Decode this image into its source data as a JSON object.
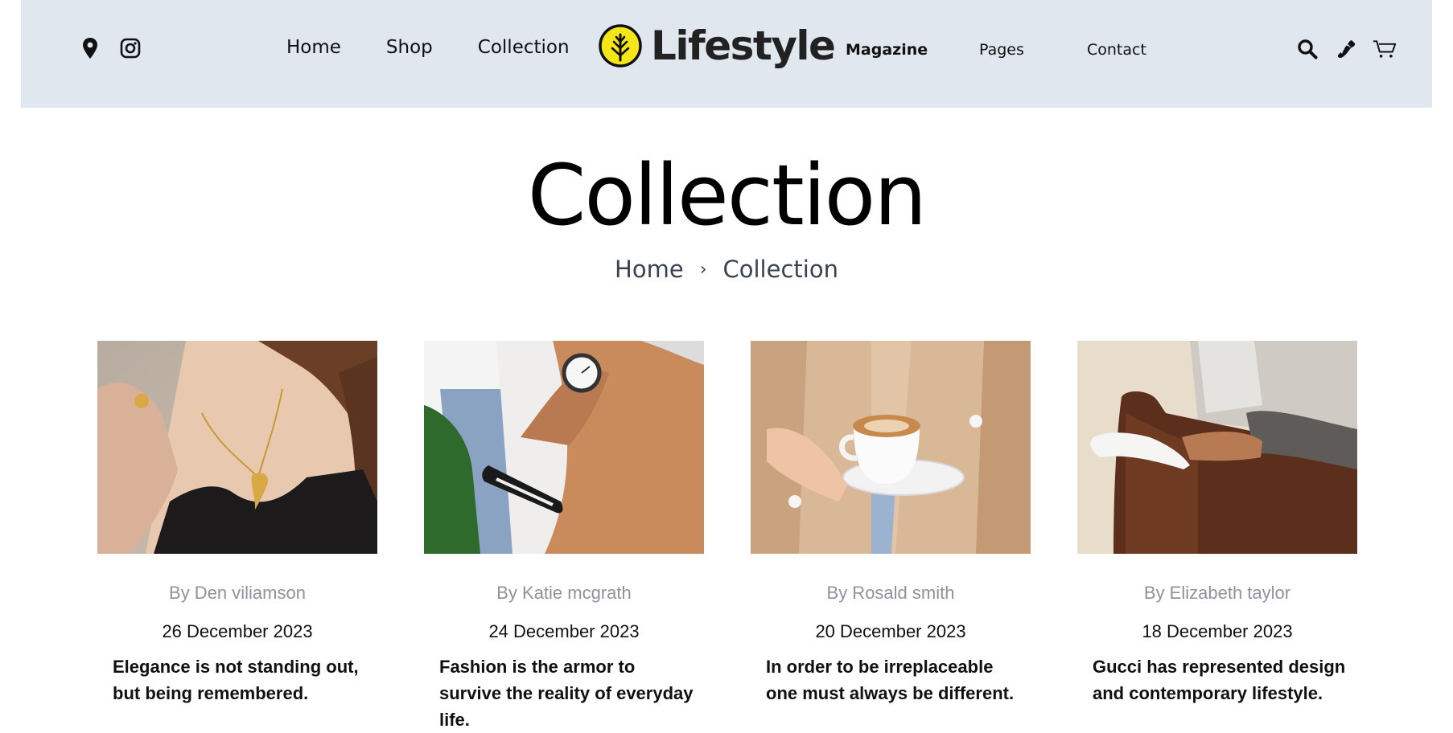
{
  "header": {
    "nav_left": [
      {
        "label": "Home"
      },
      {
        "label": "Shop"
      },
      {
        "label": "Collection"
      }
    ],
    "logo_text": "Lifestyle",
    "nav_right": [
      {
        "label": "Magazine"
      },
      {
        "label": "Pages"
      },
      {
        "label": "Contact"
      }
    ],
    "left_icons": [
      "location-pin-icon",
      "instagram-icon"
    ],
    "right_icons": [
      "search-icon",
      "phone-icon",
      "cart-icon"
    ]
  },
  "page": {
    "title": "Collection",
    "breadcrumb": {
      "home": "Home",
      "separator": "›",
      "current": "Collection"
    }
  },
  "cards": [
    {
      "author": "By Den viliamson",
      "date": "26 December 2023",
      "headline": "Elegance is not standing out, but being remembered.",
      "image": "woman-necklace-photo"
    },
    {
      "author": "By Katie mcgrath",
      "date": "24 December 2023",
      "headline": "Fashion is the armor to survive the reality of everyday life.",
      "image": "wristwatch-sunglasses-photo"
    },
    {
      "author": "By Rosald smith",
      "date": "20 December 2023",
      "headline": "In order to be irreplaceable one must always be different.",
      "image": "coffee-cup-photo"
    },
    {
      "author": "By Elizabeth taylor",
      "date": "18 December 2023",
      "headline": "Gucci has represented design and contemporary lifestyle.",
      "image": "slipper-chair-photo"
    }
  ],
  "colors": {
    "header_bg": "#e1e7ef",
    "logo_accent": "#f5e61a",
    "author_gray": "#8d929c",
    "breadcrumb_text": "#3a4250"
  }
}
